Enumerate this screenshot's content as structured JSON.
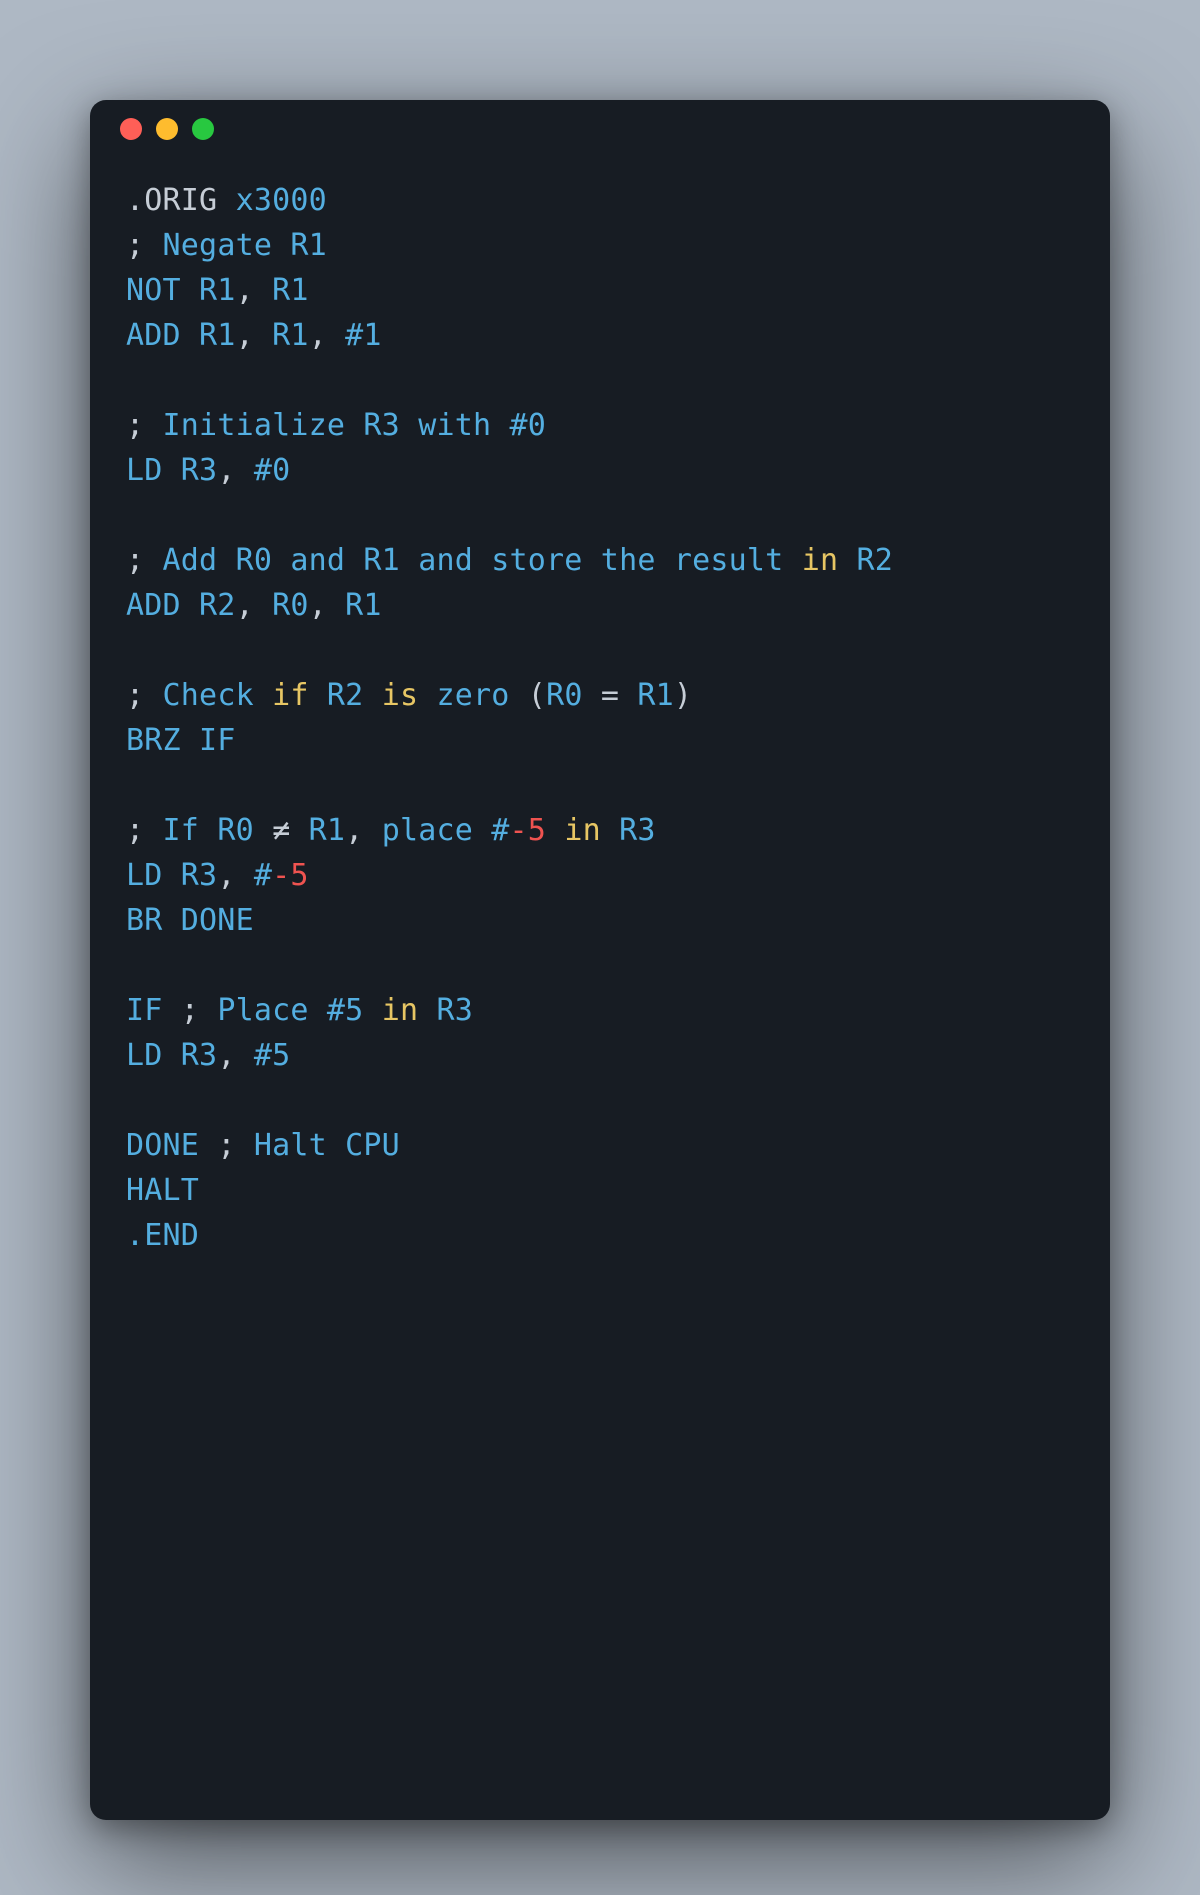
{
  "window": {
    "dot_colors": {
      "close": "#ff5f57",
      "min": "#febc2e",
      "max": "#28c840"
    }
  },
  "code": {
    "plain": ".ORIG x3000\n; Negate R1\nNOT R1, R1\nADD R1, R1, #1\n\n; Initialize R3 with #0\nLD R3, #0\n\n; Add R0 and R1 and store the result in R2\nADD R2, R0, R1\n\n; Check if R2 is zero (R0 = R1)\nBRZ IF\n\n; If R0 ≠ R1, place #-5 in R3\nLD R3, #-5\nBR DONE\n\nIF ; Place #5 in R3\nLD R3, #5\n\nDONE ; Halt CPU\nHALT\n.END",
    "tokens": [
      [
        {
          "t": ".ORIG ",
          "c": "base"
        },
        {
          "t": "x3000",
          "c": "blue"
        }
      ],
      [
        {
          "t": "; ",
          "c": "base"
        },
        {
          "t": "Negate R1",
          "c": "blue"
        }
      ],
      [
        {
          "t": "NOT R1",
          "c": "blue"
        },
        {
          "t": ", ",
          "c": "base"
        },
        {
          "t": "R1",
          "c": "blue"
        }
      ],
      [
        {
          "t": "ADD R1",
          "c": "blue"
        },
        {
          "t": ", ",
          "c": "base"
        },
        {
          "t": "R1",
          "c": "blue"
        },
        {
          "t": ", ",
          "c": "base"
        },
        {
          "t": "#1",
          "c": "blue"
        }
      ],
      [
        {
          "t": "",
          "c": "base"
        }
      ],
      [
        {
          "t": "; ",
          "c": "base"
        },
        {
          "t": "Initialize R3 with #0",
          "c": "blue"
        }
      ],
      [
        {
          "t": "LD R3",
          "c": "blue"
        },
        {
          "t": ", ",
          "c": "base"
        },
        {
          "t": "#0",
          "c": "blue"
        }
      ],
      [
        {
          "t": "",
          "c": "base"
        }
      ],
      [
        {
          "t": "; ",
          "c": "base"
        },
        {
          "t": "Add R0 and R1 and store the result ",
          "c": "blue"
        },
        {
          "t": "in",
          "c": "yellow"
        },
        {
          "t": " R2",
          "c": "blue"
        }
      ],
      [
        {
          "t": "ADD R2",
          "c": "blue"
        },
        {
          "t": ", ",
          "c": "base"
        },
        {
          "t": "R0",
          "c": "blue"
        },
        {
          "t": ", ",
          "c": "base"
        },
        {
          "t": "R1",
          "c": "blue"
        }
      ],
      [
        {
          "t": "",
          "c": "base"
        }
      ],
      [
        {
          "t": "; ",
          "c": "base"
        },
        {
          "t": "Check ",
          "c": "blue"
        },
        {
          "t": "if",
          "c": "yellow"
        },
        {
          "t": " R2 ",
          "c": "blue"
        },
        {
          "t": "is",
          "c": "yellow"
        },
        {
          "t": " zero ",
          "c": "blue"
        },
        {
          "t": "(",
          "c": "base"
        },
        {
          "t": "R0 ",
          "c": "blue"
        },
        {
          "t": "= ",
          "c": "base"
        },
        {
          "t": "R1",
          "c": "blue"
        },
        {
          "t": ")",
          "c": "base"
        }
      ],
      [
        {
          "t": "BRZ IF",
          "c": "blue"
        }
      ],
      [
        {
          "t": "",
          "c": "base"
        }
      ],
      [
        {
          "t": "; ",
          "c": "base"
        },
        {
          "t": "If R0 ",
          "c": "blue"
        },
        {
          "t": "≠ ",
          "c": "base"
        },
        {
          "t": "R1",
          "c": "blue"
        },
        {
          "t": ", ",
          "c": "base"
        },
        {
          "t": "place #",
          "c": "blue"
        },
        {
          "t": "-5",
          "c": "red"
        },
        {
          "t": " ",
          "c": "base"
        },
        {
          "t": "in",
          "c": "yellow"
        },
        {
          "t": " R3",
          "c": "blue"
        }
      ],
      [
        {
          "t": "LD R3",
          "c": "blue"
        },
        {
          "t": ", ",
          "c": "base"
        },
        {
          "t": "#",
          "c": "blue"
        },
        {
          "t": "-5",
          "c": "red"
        }
      ],
      [
        {
          "t": "BR DONE",
          "c": "blue"
        }
      ],
      [
        {
          "t": "",
          "c": "base"
        }
      ],
      [
        {
          "t": "IF ",
          "c": "blue"
        },
        {
          "t": "; ",
          "c": "base"
        },
        {
          "t": "Place #5 ",
          "c": "blue"
        },
        {
          "t": "in",
          "c": "yellow"
        },
        {
          "t": " R3",
          "c": "blue"
        }
      ],
      [
        {
          "t": "LD R3",
          "c": "blue"
        },
        {
          "t": ", ",
          "c": "base"
        },
        {
          "t": "#5",
          "c": "blue"
        }
      ],
      [
        {
          "t": "",
          "c": "base"
        }
      ],
      [
        {
          "t": "DONE ",
          "c": "blue"
        },
        {
          "t": "; ",
          "c": "base"
        },
        {
          "t": "Halt CPU",
          "c": "blue"
        }
      ],
      [
        {
          "t": "HALT",
          "c": "blue"
        }
      ],
      [
        {
          "t": ".END",
          "c": "blue"
        }
      ]
    ]
  }
}
